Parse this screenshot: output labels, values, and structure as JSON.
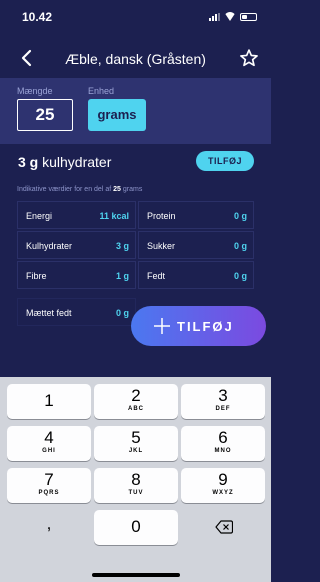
{
  "status_bar": {
    "time": "10.42"
  },
  "nav": {
    "title": "Æble, dansk (Gråsten)"
  },
  "quantity": {
    "label": "Mængde",
    "value": "25"
  },
  "unit": {
    "label": "Enhed",
    "value": "grams"
  },
  "carbs": {
    "amount": "3 g",
    "label": "kulhydrater",
    "add_label": "TILFØJ"
  },
  "info": {
    "prefix": "Indikative værdier for en del af",
    "amount": "25",
    "suffix": "grams"
  },
  "nutrition": [
    {
      "label": "Energi",
      "value": "11 kcal"
    },
    {
      "label": "Protein",
      "value": "0 g"
    },
    {
      "label": "Kulhydrater",
      "value": "3 g"
    },
    {
      "label": "Sukker",
      "value": "0 g"
    },
    {
      "label": "Fibre",
      "value": "1 g"
    },
    {
      "label": "Fedt",
      "value": "0 g"
    },
    {
      "label": "Mættet fedt",
      "value": "0 g"
    }
  ],
  "add_button": {
    "label": "TILFØJ"
  },
  "keypad": {
    "keys": [
      {
        "num": "1",
        "letters": ""
      },
      {
        "num": "2",
        "letters": "ABC"
      },
      {
        "num": "3",
        "letters": "DEF"
      },
      {
        "num": "4",
        "letters": "GHI"
      },
      {
        "num": "5",
        "letters": "JKL"
      },
      {
        "num": "6",
        "letters": "MNO"
      },
      {
        "num": "7",
        "letters": "PQRS"
      },
      {
        "num": "8",
        "letters": "TUV"
      },
      {
        "num": "9",
        "letters": "WXYZ"
      },
      {
        "num": ",",
        "letters": ""
      },
      {
        "num": "0",
        "letters": ""
      }
    ]
  },
  "icons": {
    "back": "chevron-left-icon",
    "favorite": "star-outline-icon",
    "add": "plus-icon",
    "delete": "backspace-icon"
  },
  "colors": {
    "background": "#1c2050",
    "accent": "#4fd3ef",
    "gradient_start": "#4b78f0",
    "gradient_end": "#7b4ae0"
  }
}
